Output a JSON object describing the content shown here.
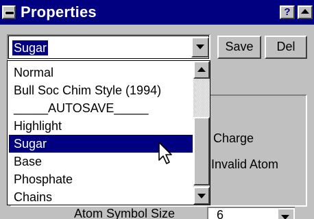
{
  "window": {
    "title": "Properties",
    "help_label": "?",
    "system_menu_icon": "system-menu-icon",
    "scroll_up_icon": "arrow-up-icon"
  },
  "style_combo": {
    "value": "Sugar",
    "dropdown_icon": "chevron-down-icon"
  },
  "buttons": {
    "save_label": "Save",
    "del_label": "Del"
  },
  "dropdown": {
    "items": [
      "Normal",
      "Bull Soc Chim Style (1994)",
      "_____AUTOSAVE_____",
      "Highlight",
      "Sugar",
      "Base",
      "Phosphate",
      "Chains"
    ],
    "selected": "Sugar"
  },
  "background_panel": {
    "charge_text": "p Charge",
    "invalid_atom_text": "t Invalid Atom",
    "atom_symbol_size_label": "Atom Symbol Size",
    "atom_symbol_size_value": "6"
  },
  "colors": {
    "titlebar": "#000080",
    "selection": "#000080",
    "face": "#c0c0c0"
  }
}
